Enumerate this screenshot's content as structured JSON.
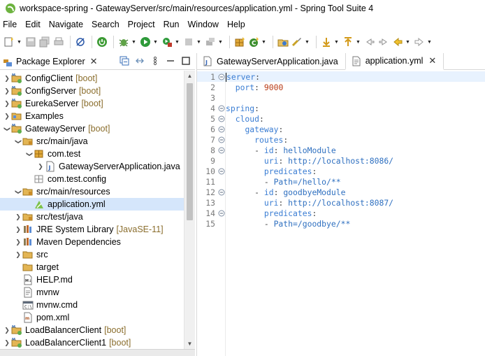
{
  "window": {
    "title": "workspace-spring - GatewayServer/src/main/resources/application.yml - Spring Tool Suite 4"
  },
  "menu": [
    "File",
    "Edit",
    "Navigate",
    "Search",
    "Project",
    "Run",
    "Window",
    "Help"
  ],
  "explorer": {
    "tab_label": "Package Explorer",
    "tree": [
      {
        "label": "ConfigClient",
        "decoration": "[boot]",
        "icon": "boot-project-icon",
        "depth": 0,
        "twisty": "collapsed",
        "selected": false
      },
      {
        "label": "ConfigServer",
        "decoration": "[boot]",
        "icon": "boot-project-icon",
        "depth": 0,
        "twisty": "collapsed",
        "selected": false
      },
      {
        "label": "EurekaServer",
        "decoration": "[boot]",
        "icon": "boot-project-icon",
        "depth": 0,
        "twisty": "collapsed",
        "selected": false
      },
      {
        "label": "Examples",
        "decoration": "",
        "icon": "project-icon",
        "depth": 0,
        "twisty": "collapsed",
        "selected": false
      },
      {
        "label": "GatewayServer",
        "decoration": "[boot]",
        "icon": "boot-project-icon",
        "depth": 0,
        "twisty": "expanded",
        "selected": false
      },
      {
        "label": "src/main/java",
        "decoration": "",
        "icon": "source-folder-icon",
        "depth": 1,
        "twisty": "expanded",
        "selected": false
      },
      {
        "label": "com.test",
        "decoration": "",
        "icon": "package-icon",
        "depth": 2,
        "twisty": "expanded",
        "selected": false
      },
      {
        "label": "GatewayServerApplication.java",
        "decoration": "",
        "icon": "java-file-icon",
        "depth": 3,
        "twisty": "collapsed",
        "selected": false
      },
      {
        "label": "com.test.config",
        "decoration": "",
        "icon": "empty-package-icon",
        "depth": 2,
        "twisty": "none",
        "selected": false
      },
      {
        "label": "src/main/resources",
        "decoration": "",
        "icon": "source-folder-icon",
        "depth": 1,
        "twisty": "expanded",
        "selected": false
      },
      {
        "label": "application.yml",
        "decoration": "",
        "icon": "yaml-file-icon",
        "depth": 2,
        "twisty": "none",
        "selected": true
      },
      {
        "label": "src/test/java",
        "decoration": "",
        "icon": "source-folder-icon",
        "depth": 1,
        "twisty": "collapsed",
        "selected": false
      },
      {
        "label": "JRE System Library",
        "decoration": "[JavaSE-11]",
        "icon": "library-icon",
        "depth": 1,
        "twisty": "collapsed",
        "selected": false
      },
      {
        "label": "Maven Dependencies",
        "decoration": "",
        "icon": "library-icon",
        "depth": 1,
        "twisty": "collapsed",
        "selected": false
      },
      {
        "label": "src",
        "decoration": "",
        "icon": "folder-icon",
        "depth": 1,
        "twisty": "collapsed",
        "selected": false
      },
      {
        "label": "target",
        "decoration": "",
        "icon": "folder-icon",
        "depth": 1,
        "twisty": "none",
        "selected": false
      },
      {
        "label": "HELP.md",
        "decoration": "",
        "icon": "markdown-file-icon",
        "depth": 1,
        "twisty": "none",
        "selected": false
      },
      {
        "label": "mvnw",
        "decoration": "",
        "icon": "text-file-icon",
        "depth": 1,
        "twisty": "none",
        "selected": false
      },
      {
        "label": "mvnw.cmd",
        "decoration": "",
        "icon": "cmd-file-icon",
        "depth": 1,
        "twisty": "none",
        "selected": false
      },
      {
        "label": "pom.xml",
        "decoration": "",
        "icon": "xml-file-icon",
        "depth": 1,
        "twisty": "none",
        "selected": false
      },
      {
        "label": "LoadBalancerClient",
        "decoration": "[boot]",
        "icon": "boot-project-icon",
        "depth": 0,
        "twisty": "collapsed",
        "selected": false
      },
      {
        "label": "LoadBalancerClient1",
        "decoration": "[boot]",
        "icon": "boot-project-icon",
        "depth": 0,
        "twisty": "collapsed",
        "selected": false
      }
    ]
  },
  "editor": {
    "tabs": [
      {
        "label": "GatewayServerApplication.java",
        "icon": "java-file-icon",
        "active": false
      },
      {
        "label": "application.yml",
        "icon": "yaml-file-icon",
        "active": true
      }
    ],
    "lines": [
      {
        "num": "1",
        "fold": true,
        "indent": "",
        "key": "server",
        "sep": ":",
        "value": "",
        "vclass": ""
      },
      {
        "num": "2",
        "fold": false,
        "indent": "  ",
        "key": "port",
        "sep": ": ",
        "value": "9000",
        "vclass": "n"
      },
      {
        "num": "3",
        "fold": false,
        "indent": "",
        "key": "",
        "sep": "",
        "value": "",
        "vclass": ""
      },
      {
        "num": "4",
        "fold": true,
        "indent": "",
        "key": "spring",
        "sep": ":",
        "value": "",
        "vclass": ""
      },
      {
        "num": "5",
        "fold": true,
        "indent": "  ",
        "key": "cloud",
        "sep": ":",
        "value": "",
        "vclass": ""
      },
      {
        "num": "6",
        "fold": true,
        "indent": "    ",
        "key": "gateway",
        "sep": ":",
        "value": "",
        "vclass": ""
      },
      {
        "num": "7",
        "fold": true,
        "indent": "      ",
        "key": "routes",
        "sep": ":",
        "value": "",
        "vclass": ""
      },
      {
        "num": "8",
        "fold": true,
        "indent": "      - ",
        "key": "id",
        "sep": ": ",
        "value": "helloModule",
        "vclass": "v"
      },
      {
        "num": "9",
        "fold": false,
        "indent": "        ",
        "key": "uri",
        "sep": ": ",
        "value": "http://localhost:8086/",
        "vclass": "v"
      },
      {
        "num": "10",
        "fold": true,
        "indent": "        ",
        "key": "predicates",
        "sep": ":",
        "value": "",
        "vclass": ""
      },
      {
        "num": "11",
        "fold": false,
        "indent": "        - ",
        "key": "",
        "sep": "",
        "value": "Path=/hello/**",
        "vclass": "v"
      },
      {
        "num": "12",
        "fold": true,
        "indent": "      - ",
        "key": "id",
        "sep": ": ",
        "value": "goodbyeModule",
        "vclass": "v"
      },
      {
        "num": "13",
        "fold": false,
        "indent": "        ",
        "key": "uri",
        "sep": ": ",
        "value": "http://localhost:8087/",
        "vclass": "v"
      },
      {
        "num": "14",
        "fold": true,
        "indent": "        ",
        "key": "predicates",
        "sep": ":",
        "value": "",
        "vclass": ""
      },
      {
        "num": "15",
        "fold": false,
        "indent": "        - ",
        "key": "",
        "sep": "",
        "value": "Path=/goodbye/**",
        "vclass": "v"
      }
    ]
  },
  "colors": {
    "selection": "#d5e6fb",
    "yaml_key": "#3a7dd3",
    "yaml_number": "#b93a15",
    "boot_decoration": "#8a6d2c"
  }
}
